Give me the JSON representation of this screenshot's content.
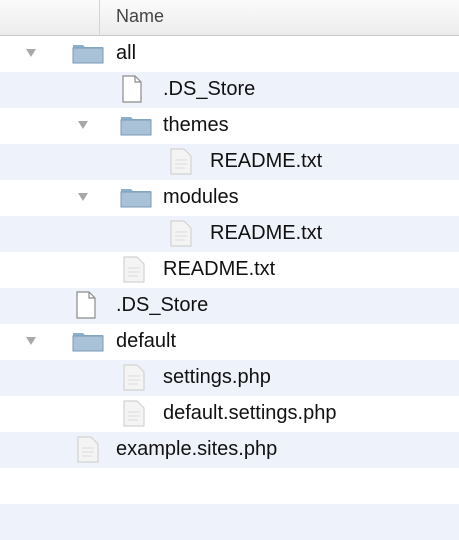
{
  "header": {
    "name_column": "Name"
  },
  "tree": [
    {
      "label": "all",
      "kind": "folder",
      "depth": 0,
      "expanded": true
    },
    {
      "label": ".DS_Store",
      "kind": "file",
      "depth": 1
    },
    {
      "label": "themes",
      "kind": "folder",
      "depth": 1,
      "expanded": true
    },
    {
      "label": "README.txt",
      "kind": "doc",
      "depth": 2
    },
    {
      "label": "modules",
      "kind": "folder",
      "depth": 1,
      "expanded": true
    },
    {
      "label": "README.txt",
      "kind": "doc",
      "depth": 2
    },
    {
      "label": "README.txt",
      "kind": "doc",
      "depth": 1
    },
    {
      "label": ".DS_Store",
      "kind": "file",
      "depth": 0
    },
    {
      "label": "default",
      "kind": "folder",
      "depth": 0,
      "expanded": true
    },
    {
      "label": "settings.php",
      "kind": "doc",
      "depth": 1
    },
    {
      "label": "default.settings.php",
      "kind": "doc",
      "depth": 1
    },
    {
      "label": "example.sites.php",
      "kind": "doc",
      "depth": 0
    }
  ],
  "colors": {
    "alt_row": "#eef3fb",
    "folder_body": "#a9c2d8",
    "folder_tab": "#8fb0cc",
    "disclosure": "#a8a8a8"
  }
}
